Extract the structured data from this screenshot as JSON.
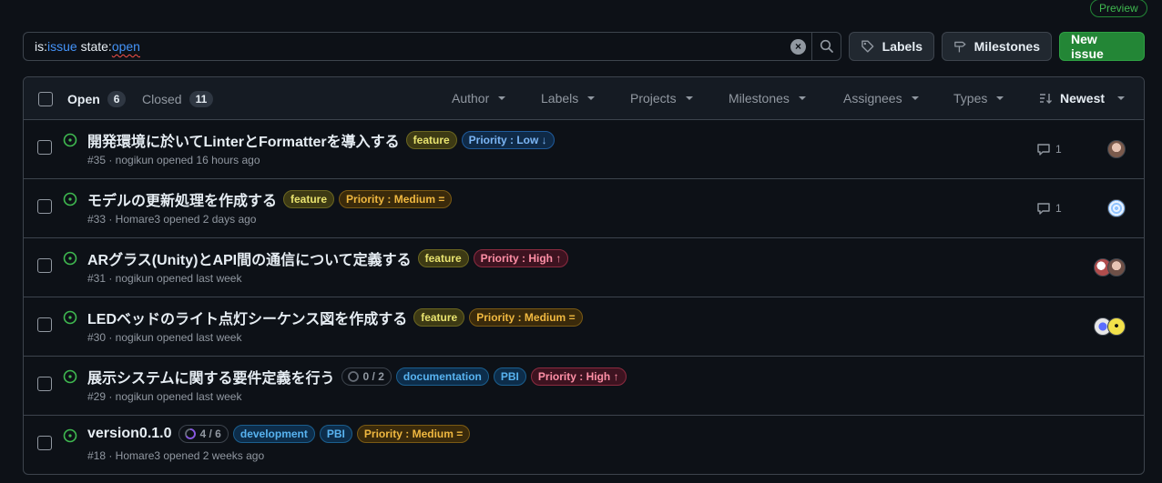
{
  "preview_badge": "Preview",
  "search": {
    "qualifiers": [
      {
        "key": "is:",
        "value": "issue",
        "squiggle": false
      },
      {
        "key": " state:",
        "value": "open",
        "squiggle": true
      }
    ],
    "clear_icon": "x-circle-fill-icon",
    "search_icon": "search-icon"
  },
  "buttons": {
    "labels": "Labels",
    "milestones": "Milestones",
    "new_issue": "New issue"
  },
  "header": {
    "open_label": "Open",
    "open_count": "6",
    "closed_label": "Closed",
    "closed_count": "11",
    "filters": [
      "Author",
      "Labels",
      "Projects",
      "Milestones",
      "Assignees",
      "Types"
    ],
    "sort_label": "Newest"
  },
  "colors": {
    "accent_green": "#238636",
    "open_icon": "#3fb950",
    "link_blue": "#4493f8"
  },
  "issues": [
    {
      "title": "開発環境に於いてLinterとFormatterを導入する",
      "labels": [
        {
          "text": "feature",
          "kind": "feature"
        },
        {
          "text": "Priority : Low ↓",
          "kind": "low"
        }
      ],
      "meta": "#35 · nogikun opened 16 hours ago",
      "comments": "1",
      "avatars": [
        "a"
      ]
    },
    {
      "title": "モデルの更新処理を作成する",
      "labels": [
        {
          "text": "feature",
          "kind": "feature"
        },
        {
          "text": "Priority : Medium =",
          "kind": "medium"
        }
      ],
      "meta": "#33 · Homare3 opened 2 days ago",
      "comments": "1",
      "avatars": [
        "b"
      ]
    },
    {
      "title": "ARグラス(Unity)とAPI間の通信について定義する",
      "labels": [
        {
          "text": "feature",
          "kind": "feature"
        },
        {
          "text": "Priority : High ↑",
          "kind": "high"
        }
      ],
      "meta": "#31 · nogikun opened last week",
      "comments": "",
      "avatars": [
        "c",
        "d"
      ]
    },
    {
      "title": "LEDベッドのライト点灯シーケンス図を作成する",
      "labels": [
        {
          "text": "feature",
          "kind": "feature"
        },
        {
          "text": "Priority : Medium =",
          "kind": "medium"
        }
      ],
      "meta": "#30 · nogikun opened last week",
      "comments": "",
      "avatars": [
        "e",
        "f"
      ]
    },
    {
      "title": "展示システムに関する要件定義を行う",
      "progress": {
        "text": "0 / 2",
        "fraction": 0
      },
      "labels": [
        {
          "text": "documentation",
          "kind": "doc"
        },
        {
          "text": "PBI",
          "kind": "pbi"
        },
        {
          "text": "Priority : High ↑",
          "kind": "high"
        }
      ],
      "meta": "#29 · nogikun opened last week",
      "comments": "",
      "avatars": []
    },
    {
      "title": "version0.1.0",
      "progress": {
        "text": "4 / 6",
        "fraction": 0.667
      },
      "labels": [
        {
          "text": "development",
          "kind": "dev"
        },
        {
          "text": "PBI",
          "kind": "pbi"
        },
        {
          "text": "Priority : Medium =",
          "kind": "medium"
        }
      ],
      "meta": "#18 · Homare3 opened 2 weeks ago",
      "comments": "",
      "avatars": []
    }
  ]
}
